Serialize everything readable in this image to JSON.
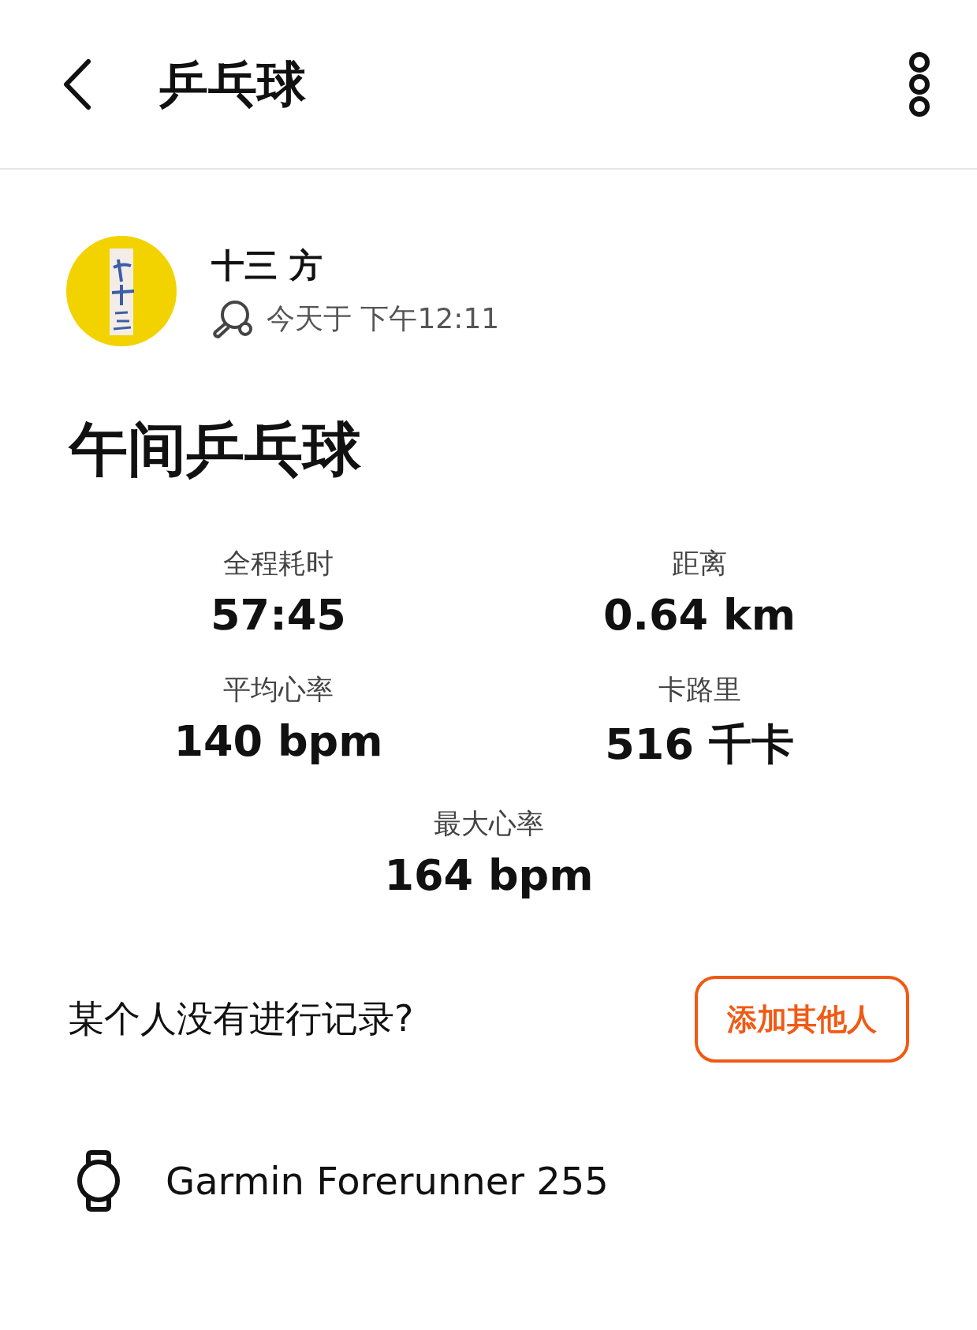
{
  "header": {
    "title": "乒乓球"
  },
  "athlete": {
    "name": "十三 方",
    "time": "今天于 下午12:11"
  },
  "activity": {
    "title": "午间乒乓球"
  },
  "stats": [
    {
      "label": "全程耗时",
      "value": "57:45"
    },
    {
      "label": "距离",
      "value": "0.64 km"
    },
    {
      "label": "平均心率",
      "value": "140 bpm"
    },
    {
      "label": "卡路里",
      "value": "516 千卡"
    },
    {
      "label": "最大心率",
      "value": "164 bpm"
    }
  ],
  "add_people": {
    "question": "某个人没有进行记录?",
    "button": "添加其他人"
  },
  "device": {
    "name": "Garmin Forerunner 255"
  }
}
